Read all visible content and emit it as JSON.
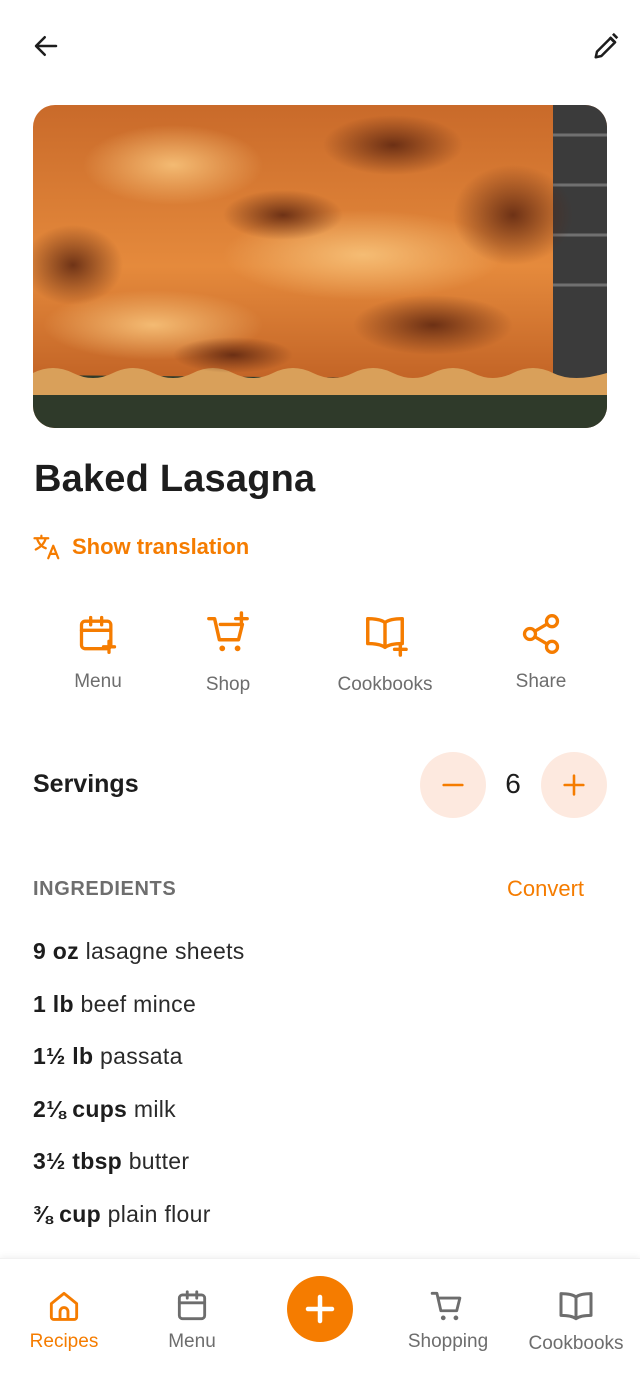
{
  "recipe": {
    "title": "Baked Lasagna",
    "show_translation": "Show translation"
  },
  "actions": [
    {
      "label": "Menu",
      "icon": "calendar-plus-icon"
    },
    {
      "label": "Shop",
      "icon": "cart-plus-icon"
    },
    {
      "label": "Cookbooks",
      "icon": "book-plus-icon"
    },
    {
      "label": "Share",
      "icon": "share-icon"
    }
  ],
  "servings": {
    "label": "Servings",
    "count": "6"
  },
  "ingredients_section": {
    "heading": "INGREDIENTS",
    "convert": "Convert",
    "items": [
      {
        "qty": "9 oz",
        "name": "lasagne sheets"
      },
      {
        "qty": "1 lb",
        "name": "beef mince"
      },
      {
        "qty": "1½ lb",
        "name": "passata"
      },
      {
        "qty": "2⅛ cups",
        "name": "milk"
      },
      {
        "qty": "3½ tbsp",
        "name": "butter"
      },
      {
        "qty": "⅜ cup",
        "name": "plain flour"
      }
    ]
  },
  "bottom_nav": {
    "items": [
      {
        "label": "Recipes",
        "icon": "home-icon",
        "active": true
      },
      {
        "label": "Menu",
        "icon": "calendar-icon"
      },
      {
        "label": "Shopping",
        "icon": "cart-icon"
      },
      {
        "label": "Cookbooks",
        "icon": "book-icon"
      }
    ]
  },
  "colors": {
    "accent": "#f57c00",
    "accent_soft": "#fde9df",
    "text": "#1d1d1d",
    "muted": "#6d6d6d"
  }
}
